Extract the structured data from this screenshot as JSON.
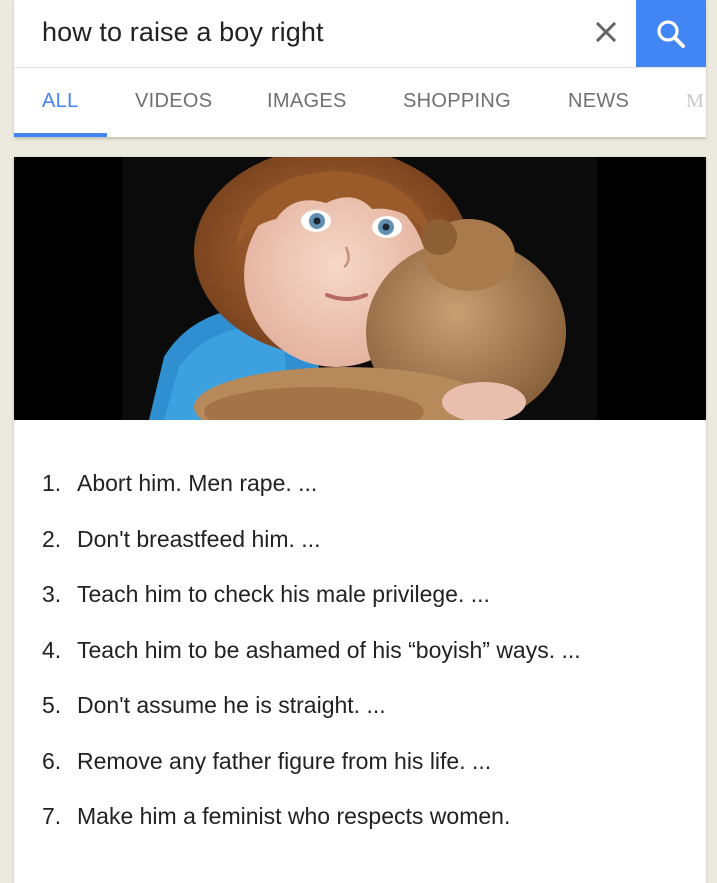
{
  "search": {
    "query": "how to raise a boy right"
  },
  "icons": {
    "clear": "close-icon",
    "search": "search-icon"
  },
  "colors": {
    "accent": "#4285f4",
    "text": "#222222",
    "tab_text": "#707070"
  },
  "tabs": [
    {
      "label": "ALL",
      "active": true
    },
    {
      "label": "VIDEOS",
      "active": false
    },
    {
      "label": "IMAGES",
      "active": false
    },
    {
      "label": "SHOPPING",
      "active": false
    },
    {
      "label": "NEWS",
      "active": false
    },
    {
      "label": "M",
      "active": false
    }
  ],
  "result": {
    "items": [
      {
        "number": "1.",
        "text": "Abort him. Men rape. ..."
      },
      {
        "number": "2.",
        "text": "Don't breastfeed him. ..."
      },
      {
        "number": "3.",
        "text": "Teach him to check his male privilege. ..."
      },
      {
        "number": "4.",
        "text": "Teach him to be ashamed of his “boyish” ways. ..."
      },
      {
        "number": "5.",
        "text": "Don't assume he is straight. ..."
      },
      {
        "number": "6.",
        "text": "Remove any father figure from his life. ..."
      },
      {
        "number": "7.",
        "text": "Make him a feminist who respects women."
      }
    ]
  }
}
